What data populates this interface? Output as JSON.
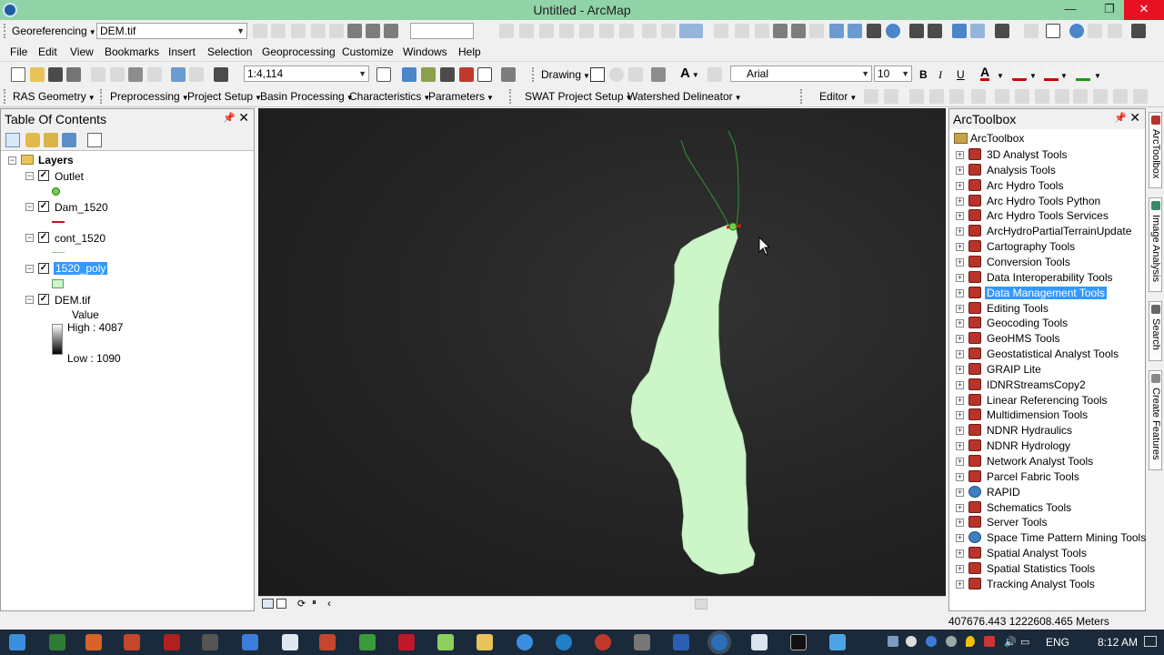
{
  "window": {
    "title": "Untitled - ArcMap",
    "min": "—",
    "max": "❐",
    "close": "✕"
  },
  "georef": {
    "label": "Georeferencing",
    "layer": "DEM.tif"
  },
  "menu": [
    "File",
    "Edit",
    "View",
    "Bookmarks",
    "Insert",
    "Selection",
    "Geoprocessing",
    "Customize",
    "Windows",
    "Help"
  ],
  "standard": {
    "scale": "1:4,114",
    "drawing": "Drawing",
    "font": "Arial",
    "font_size": "10"
  },
  "row4": {
    "items": [
      "RAS Geometry",
      "Preprocessing",
      "Project Setup",
      "Basin Processing",
      "Characteristics",
      "Parameters",
      "SWAT Project Setup",
      "Watershed Delineator",
      "Editor"
    ]
  },
  "toc": {
    "title": "Table Of Contents",
    "root": "Layers",
    "layers": [
      "Outlet",
      "Dam_1520",
      "cont_1520",
      "1520_poly",
      "DEM.tif"
    ],
    "legend": {
      "value": "Value",
      "high": "High : 4087",
      "low": "Low : 1090"
    }
  },
  "toolbox": {
    "title": "ArcToolbox",
    "root": "ArcToolbox",
    "items": [
      "3D Analyst Tools",
      "Analysis Tools",
      "Arc Hydro Tools",
      "Arc Hydro Tools Python",
      "Arc Hydro Tools Services",
      "ArcHydroPartialTerrainUpdate",
      "Cartography Tools",
      "Conversion Tools",
      "Data Interoperability Tools",
      "Data Management Tools",
      "Editing Tools",
      "Geocoding Tools",
      "GeoHMS Tools",
      "Geostatistical Analyst Tools",
      "GRAIP Lite",
      "IDNRStreamsCopy2",
      "Linear Referencing Tools",
      "Multidimension Tools",
      "NDNR Hydraulics",
      "NDNR Hydrology",
      "Network Analyst Tools",
      "Parcel Fabric Tools",
      "RAPID",
      "Schematics Tools",
      "Server Tools",
      "Space Time Pattern Mining Tools",
      "Spatial Analyst Tools",
      "Spatial Statistics Tools",
      "Tracking Analyst Tools"
    ],
    "selected": "Data Management Tools"
  },
  "side_tabs": [
    "ArcToolbox",
    "Image Analysis",
    "Search",
    "Create Features"
  ],
  "status": {
    "coords": "407676.443  1222608.465 Meters"
  },
  "taskbar": {
    "lang": "ENG",
    "time": "8:12 AM"
  },
  "colors": {
    "titlebar": "#8fd3a7",
    "polygon": "#ccf5c8",
    "stream": "#2d9a2d",
    "selection": "#3399ff"
  }
}
